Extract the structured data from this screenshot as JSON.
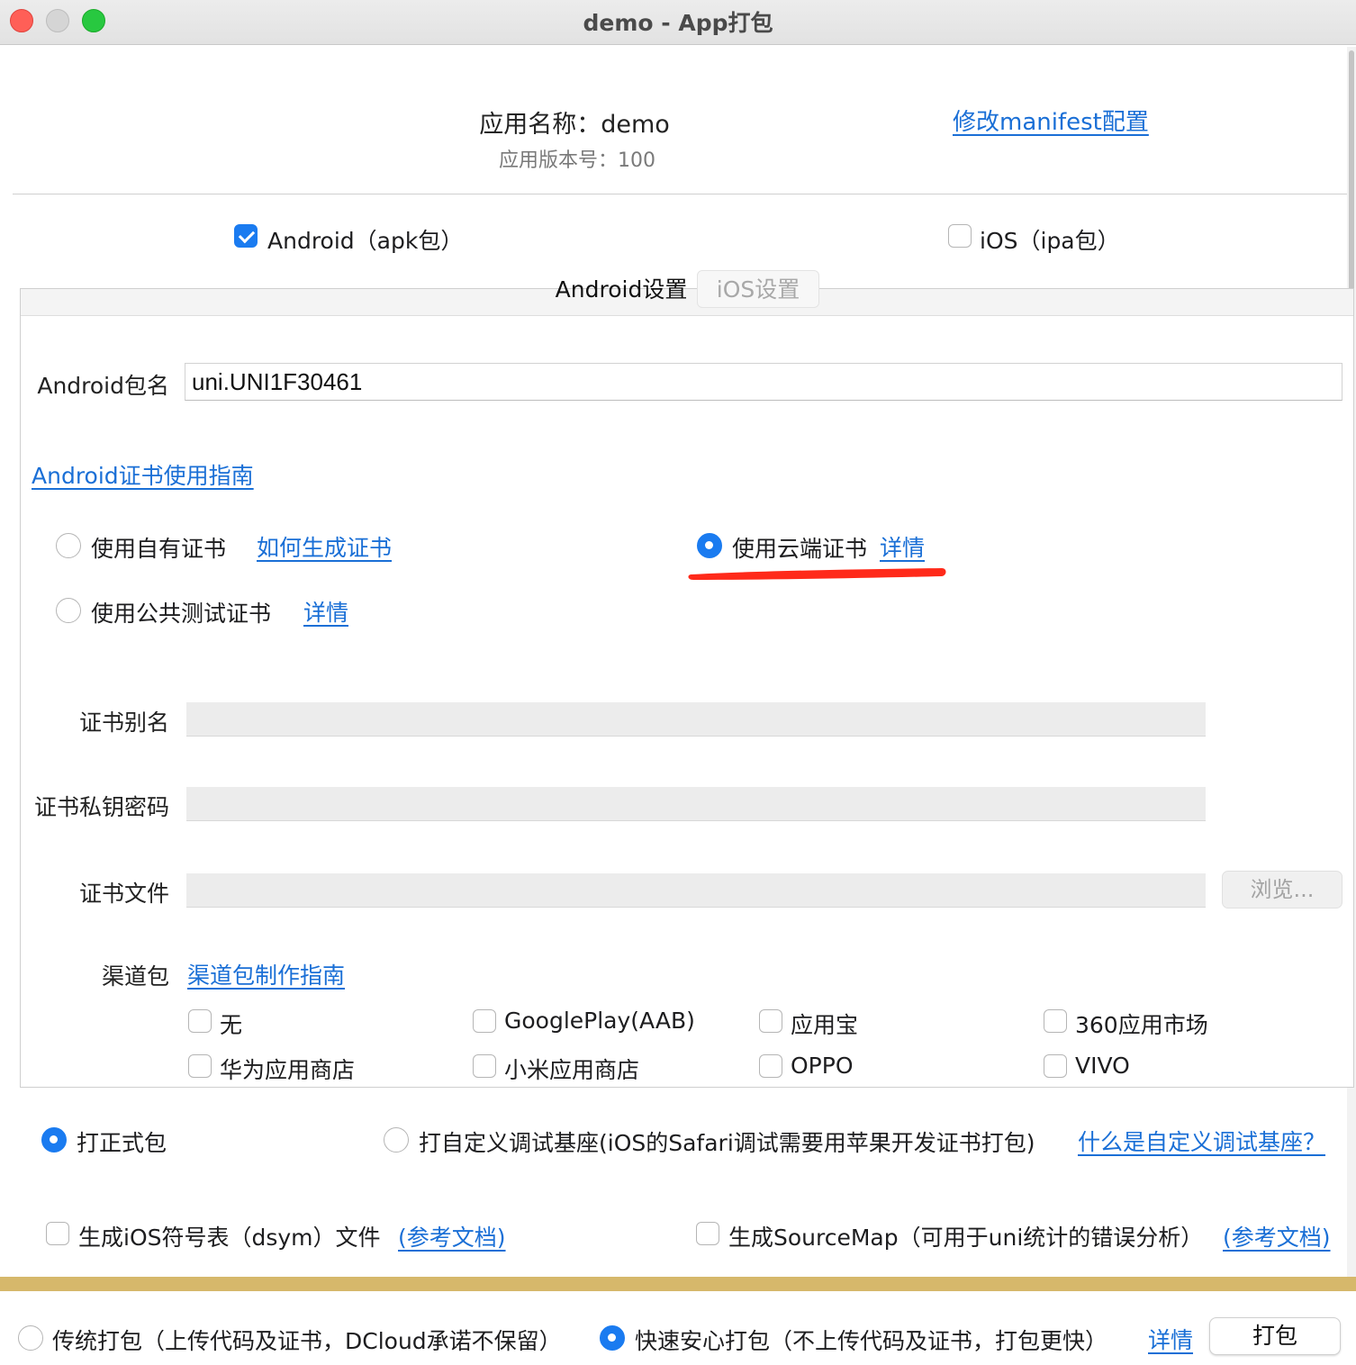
{
  "window": {
    "title": "demo - App打包"
  },
  "header": {
    "app_name": "应用名称：demo",
    "app_version": "应用版本号：100",
    "manifest_link": "修改manifest配置"
  },
  "platforms": {
    "android": {
      "label": "Android（apk包）",
      "checked": true
    },
    "ios": {
      "label": "iOS（ipa包）",
      "checked": false
    }
  },
  "tabs": {
    "android": "Android设置",
    "ios": "iOS设置"
  },
  "android": {
    "package_label": "Android包名",
    "package_value": "uni.UNI1F30461",
    "cert_guide_link": "Android证书使用指南",
    "cert_options": {
      "own": "使用自有证书",
      "own_link": "如何生成证书",
      "cloud": "使用云端证书",
      "cloud_link": "详情",
      "public": "使用公共测试证书",
      "public_link": "详情",
      "selected": "cloud"
    },
    "alias_label": "证书别名",
    "password_label": "证书私钥密码",
    "file_label": "证书文件",
    "browse_label": "浏览...",
    "channel_label": "渠道包",
    "channel_link": "渠道包制作指南",
    "channels": [
      "无",
      "GooglePlay(AAB)",
      "应用宝",
      "360应用市场",
      "华为应用商店",
      "小米应用商店",
      "OPPO",
      "VIVO"
    ]
  },
  "build_type": {
    "release": "打正式包",
    "custom_base": "打自定义调试基座(iOS的Safari调试需要用苹果开发证书打包)",
    "custom_base_link": "什么是自定义调试基座？",
    "selected": "release"
  },
  "extras": {
    "dsym": "生成iOS符号表（dsym）文件",
    "dsym_link": "(参考文档)",
    "sourcemap": "生成SourceMap（可用于uni统计的错误分析）",
    "sourcemap_link": "(参考文档)"
  },
  "footer": {
    "traditional": "传统打包（上传代码及证书，DCloud承诺不保留）",
    "fast": "快速安心打包（不上传代码及证书，打包更快）",
    "details_link": "详情",
    "pack_button": "打包",
    "selected": "fast"
  },
  "colors": {
    "accent": "#1a7bf0",
    "link": "#1a6fd6",
    "annotation": "#ff2a1a",
    "gold_bar": "#d6b86b"
  }
}
